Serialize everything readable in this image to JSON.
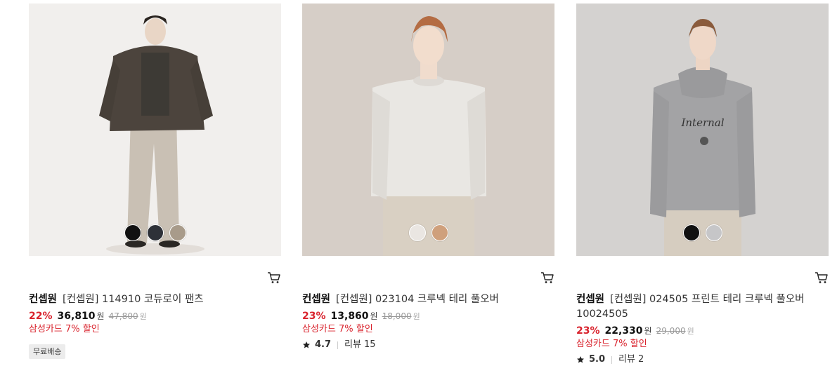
{
  "products": [
    {
      "brand": "컨셉원",
      "title": "[컨셉원] 114910 코듀로이 팬츠",
      "discount": "22%",
      "price": "36,810",
      "currency": "원",
      "original_price": "47,800",
      "promo": "삼성카드 7% 할인",
      "badge": "무료배송",
      "swatches": [
        "#111111",
        "#2e3138",
        "#a89b8a"
      ],
      "background": "#f1efed"
    },
    {
      "brand": "컨셉원",
      "title": "[컨셉원] 023104 크루넥 테리 풀오버",
      "discount": "23%",
      "price": "13,860",
      "currency": "원",
      "original_price": "18,000",
      "promo": "삼성카드 7% 할인",
      "rating": "4.7",
      "reviews_label": "리뷰",
      "reviews_count": "15",
      "swatches": [
        "#eae6e2",
        "#cfa07c"
      ],
      "background": "#d6cec7"
    },
    {
      "brand": "컨셉원",
      "title": "[컨셉원] 024505 프린트 테리 크루넥 풀오버 10024505",
      "discount": "23%",
      "price": "22,330",
      "currency": "원",
      "original_price": "29,000",
      "promo": "삼성카드 7% 할인",
      "rating": "5.0",
      "reviews_label": "리뷰",
      "reviews_count": "2",
      "swatches": [
        "#111111",
        "#c6c6c8"
      ],
      "background": "#d4d2d0"
    }
  ],
  "icons": {
    "cart": "cart-icon",
    "star": "star-icon"
  },
  "colors": {
    "discount": "#d9232d",
    "promo": "#d9232d"
  }
}
